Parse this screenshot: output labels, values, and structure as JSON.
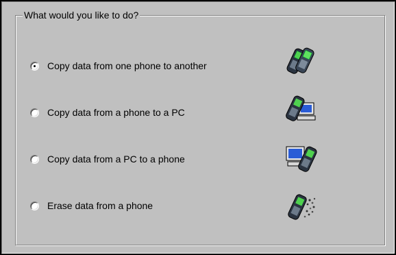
{
  "group": {
    "title": "What would you like to do?"
  },
  "options": [
    {
      "label": "Copy data from one phone to another",
      "selected": true,
      "icon": "phone-to-phone-icon"
    },
    {
      "label": "Copy data from a phone to a PC",
      "selected": false,
      "icon": "phone-to-pc-icon"
    },
    {
      "label": "Copy data from a PC to a phone",
      "selected": false,
      "icon": "pc-to-phone-icon"
    },
    {
      "label": "Erase data from a phone",
      "selected": false,
      "icon": "erase-phone-icon"
    }
  ]
}
